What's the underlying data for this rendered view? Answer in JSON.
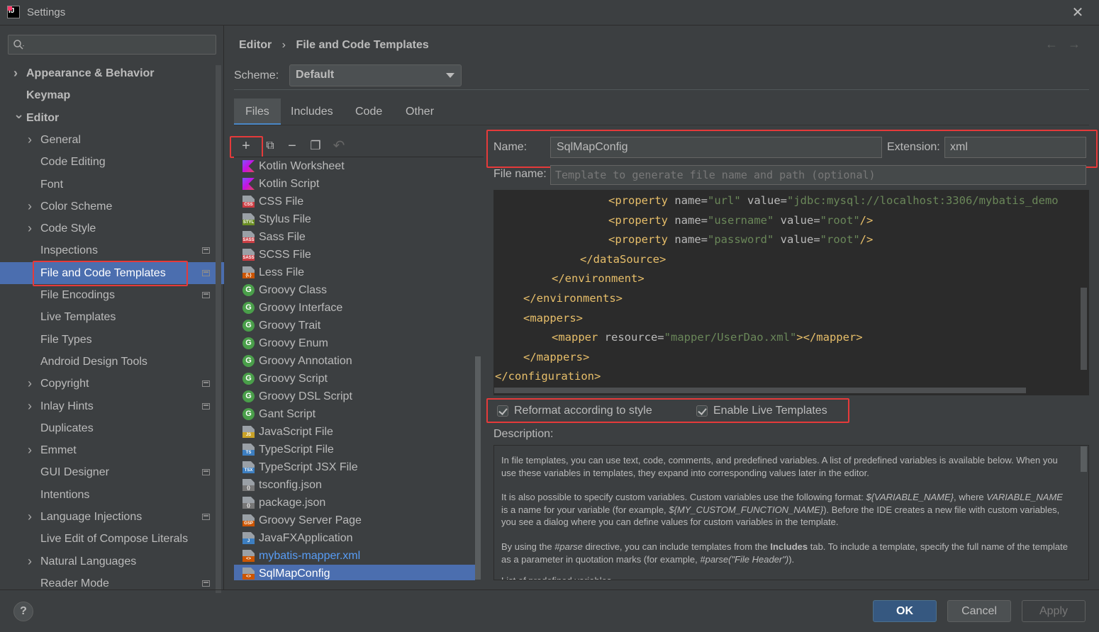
{
  "window": {
    "title": "Settings"
  },
  "sidebar": {
    "search_placeholder": "",
    "items": [
      {
        "label": "Appearance & Behavior",
        "level": 0,
        "chevron": "right",
        "bold": true
      },
      {
        "label": "Keymap",
        "level": 0,
        "chevron": "none",
        "bold": true
      },
      {
        "label": "Editor",
        "level": 0,
        "chevron": "down",
        "bold": true
      },
      {
        "label": "General",
        "level": 1,
        "chevron": "right"
      },
      {
        "label": "Code Editing",
        "level": 1,
        "chevron": "none"
      },
      {
        "label": "Font",
        "level": 1,
        "chevron": "none"
      },
      {
        "label": "Color Scheme",
        "level": 1,
        "chevron": "right"
      },
      {
        "label": "Code Style",
        "level": 1,
        "chevron": "right"
      },
      {
        "label": "Inspections",
        "level": 1,
        "chevron": "none",
        "project_icon": true
      },
      {
        "label": "File and Code Templates",
        "level": 1,
        "chevron": "none",
        "selected": true,
        "project_icon": true
      },
      {
        "label": "File Encodings",
        "level": 1,
        "chevron": "none",
        "project_icon": true
      },
      {
        "label": "Live Templates",
        "level": 1,
        "chevron": "none"
      },
      {
        "label": "File Types",
        "level": 1,
        "chevron": "none"
      },
      {
        "label": "Android Design Tools",
        "level": 1,
        "chevron": "none"
      },
      {
        "label": "Copyright",
        "level": 1,
        "chevron": "right",
        "project_icon": true
      },
      {
        "label": "Inlay Hints",
        "level": 1,
        "chevron": "right",
        "project_icon": true
      },
      {
        "label": "Duplicates",
        "level": 1,
        "chevron": "none"
      },
      {
        "label": "Emmet",
        "level": 1,
        "chevron": "right"
      },
      {
        "label": "GUI Designer",
        "level": 1,
        "chevron": "none",
        "project_icon": true
      },
      {
        "label": "Intentions",
        "level": 1,
        "chevron": "none"
      },
      {
        "label": "Language Injections",
        "level": 1,
        "chevron": "right",
        "project_icon": true
      },
      {
        "label": "Live Edit of Compose Literals",
        "level": 1,
        "chevron": "none"
      },
      {
        "label": "Natural Languages",
        "level": 1,
        "chevron": "right"
      },
      {
        "label": "Reader Mode",
        "level": 1,
        "chevron": "none",
        "project_icon": true
      }
    ]
  },
  "header": {
    "breadcrumb": [
      "Editor",
      "File and Code Templates"
    ],
    "breadcrumb_sep": "›",
    "back_icon": "←",
    "forward_icon": "→"
  },
  "scheme": {
    "label": "Scheme:",
    "value": "Default"
  },
  "tabs": [
    {
      "label": "Files",
      "active": true
    },
    {
      "label": "Includes"
    },
    {
      "label": "Code"
    },
    {
      "label": "Other"
    }
  ],
  "toolbar": {
    "add": "+",
    "copy": "⧉",
    "remove": "−",
    "duplicate": "❐",
    "reset": "↶"
  },
  "templates": [
    {
      "label": "Kotlin Worksheet",
      "icon": "kotlin"
    },
    {
      "label": "Kotlin Script",
      "icon": "kotlin"
    },
    {
      "label": "CSS File",
      "icon": "file",
      "tag": "CSS",
      "tag_color": "#cc3e44"
    },
    {
      "label": "Stylus File",
      "icon": "file",
      "tag": "STYL",
      "tag_color": "#6b8e23"
    },
    {
      "label": "Sass File",
      "icon": "file",
      "tag": "SASS",
      "tag_color": "#cc3e44"
    },
    {
      "label": "SCSS File",
      "icon": "file",
      "tag": "SASS",
      "tag_color": "#cc3e44"
    },
    {
      "label": "Less File",
      "icon": "file",
      "tag": "{L}",
      "tag_color": "#cc5500"
    },
    {
      "label": "Groovy Class",
      "icon": "groovy"
    },
    {
      "label": "Groovy Interface",
      "icon": "groovy"
    },
    {
      "label": "Groovy Trait",
      "icon": "groovy"
    },
    {
      "label": "Groovy Enum",
      "icon": "groovy"
    },
    {
      "label": "Groovy Annotation",
      "icon": "groovy"
    },
    {
      "label": "Groovy Script",
      "icon": "groovy"
    },
    {
      "label": "Groovy DSL Script",
      "icon": "groovy"
    },
    {
      "label": "Gant Script",
      "icon": "groovy"
    },
    {
      "label": "JavaScript File",
      "icon": "file",
      "tag": "JS",
      "tag_color": "#c9a227"
    },
    {
      "label": "TypeScript File",
      "icon": "file",
      "tag": "TS",
      "tag_color": "#3d7fc1"
    },
    {
      "label": "TypeScript JSX File",
      "icon": "file",
      "tag": "TSX",
      "tag_color": "#3d7fc1"
    },
    {
      "label": "tsconfig.json",
      "icon": "file",
      "tag": "{}",
      "tag_color": "#777777"
    },
    {
      "label": "package.json",
      "icon": "file",
      "tag": "{}",
      "tag_color": "#777777"
    },
    {
      "label": "Groovy Server Page",
      "icon": "file",
      "tag": "GSP",
      "tag_color": "#cc5500"
    },
    {
      "label": "JavaFXApplication",
      "icon": "file",
      "tag": "J",
      "tag_color": "#3d7fc1"
    },
    {
      "label": "mybatis-mapper.xml",
      "icon": "file",
      "tag": "<>",
      "tag_color": "#cc5500",
      "blue": true
    },
    {
      "label": "SqlMapConfig",
      "icon": "file",
      "tag": "<>",
      "tag_color": "#cc5500",
      "selected": true
    }
  ],
  "form": {
    "name_label": "Name:",
    "name_value": "SqlMapConfig",
    "extension_label": "Extension:",
    "extension_value": "xml",
    "filename_label": "File name:",
    "filename_placeholder": "Template to generate file name and path (optional)"
  },
  "editor": {
    "lines": [
      {
        "indent": 4,
        "parts": [
          [
            "tg",
            "<property "
          ],
          [
            "at",
            "name="
          ],
          [
            "st",
            "\"url\""
          ],
          [
            "at",
            " value="
          ],
          [
            "st",
            "\"jdbc:mysql://localhost:3306/mybatis_demo"
          ]
        ]
      },
      {
        "indent": 4,
        "parts": [
          [
            "tg",
            "<property "
          ],
          [
            "at",
            "name="
          ],
          [
            "st",
            "\"username\""
          ],
          [
            "at",
            " value="
          ],
          [
            "st",
            "\"root\""
          ],
          [
            "tg",
            "/>"
          ]
        ]
      },
      {
        "indent": 4,
        "parts": [
          [
            "tg",
            "<property "
          ],
          [
            "at",
            "name="
          ],
          [
            "st",
            "\"password\""
          ],
          [
            "at",
            " value="
          ],
          [
            "st",
            "\"root\""
          ],
          [
            "tg",
            "/>"
          ]
        ]
      },
      {
        "indent": 3,
        "parts": [
          [
            "tg",
            "</dataSource>"
          ]
        ]
      },
      {
        "indent": 2,
        "parts": [
          [
            "tg",
            "</environment>"
          ]
        ]
      },
      {
        "indent": 1,
        "parts": [
          [
            "tg",
            "</environments>"
          ]
        ]
      },
      {
        "indent": 1,
        "parts": [
          [
            "tg",
            "<mappers>"
          ]
        ]
      },
      {
        "indent": 2,
        "parts": [
          [
            "tg",
            "<mapper "
          ],
          [
            "at",
            "resource="
          ],
          [
            "st",
            "\"mapper/UserDao.xml\""
          ],
          [
            "tg",
            "></mapper>"
          ]
        ]
      },
      {
        "indent": 1,
        "parts": [
          [
            "tg",
            "</mappers>"
          ]
        ]
      },
      {
        "indent": 0,
        "parts": [
          [
            "tg",
            "</configuration>"
          ]
        ]
      }
    ]
  },
  "options": {
    "reformat_label": "Reformat according to style",
    "reformat_checked": true,
    "live_templates_label": "Enable Live Templates",
    "live_templates_checked": true
  },
  "description": {
    "label": "Description:",
    "p1": "In file templates, you can use text, code, comments, and predefined variables. A list of predefined variables is available below. When you use these variables in templates, they expand into corresponding values later in the editor.",
    "p2_a": "It is also possible to specify custom variables. Custom variables use the following format: ",
    "p2_var": "${VARIABLE_NAME}",
    "p2_b": ", where ",
    "p2_var2": "VARIABLE_NAME",
    "p2_c": " is a name for your variable (for example, ",
    "p2_var3": "${MY_CUSTOM_FUNCTION_NAME}",
    "p2_d": "). Before the IDE creates a new file with custom variables, you see a dialog where you can define values for custom variables in the template.",
    "p3_a": "By using the ",
    "p3_parse": "#parse",
    "p3_b": " directive, you can include templates from the ",
    "p3_includes": "Includes",
    "p3_c": " tab. To include a template, specify the full name of the template as a parameter in quotation marks (for example, ",
    "p3_ex": "#parse(\"File Header\")",
    "p3_d": ").",
    "p4": "List of predefined variables"
  },
  "footer": {
    "help": "?",
    "ok": "OK",
    "cancel": "Cancel",
    "apply": "Apply"
  },
  "colors": {
    "background": "#3c3f41",
    "selection": "#4b6eaf",
    "primary_button": "#365880",
    "highlight_box": "#e53a3a"
  }
}
